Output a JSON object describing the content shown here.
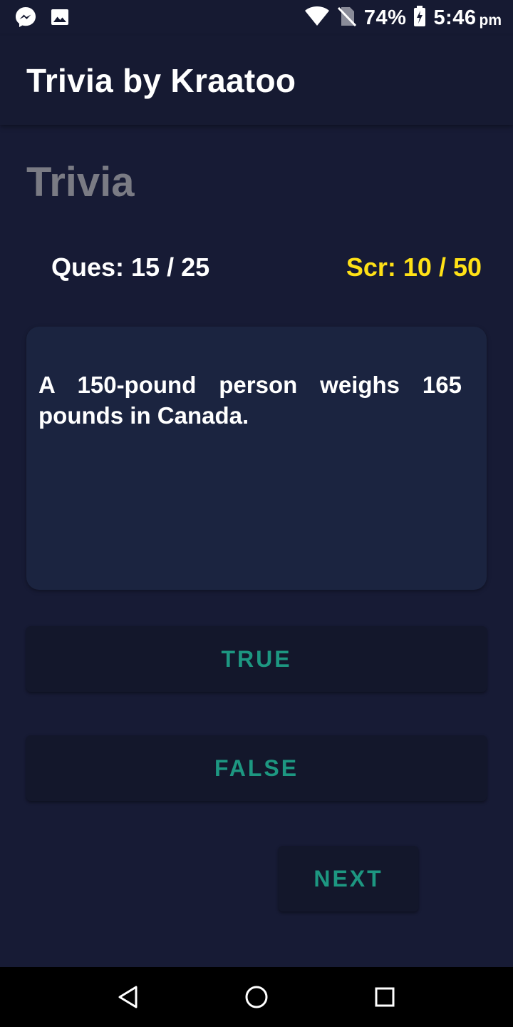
{
  "status_bar": {
    "icons_left": [
      "messenger-icon",
      "gallery-icon"
    ],
    "icons_right": [
      "wifi-icon",
      "no-sim-icon",
      "battery-charging-icon"
    ],
    "battery": "74%",
    "time": "5:46",
    "ampm": "pm"
  },
  "app_bar": {
    "title": "Trivia by Kraatoo"
  },
  "main": {
    "heading": "Trivia",
    "question_counter": "Ques: 15 / 25",
    "score": "Scr: 10 / 50",
    "question": "A 150-pound person weighs 165 pounds in Canada.",
    "answers": [
      "TRUE",
      "FALSE"
    ],
    "next_label": "NEXT"
  },
  "nav_bar": {
    "icons": [
      "back-icon",
      "home-icon",
      "recents-icon"
    ]
  },
  "colors": {
    "background": "#171b35",
    "card": "#1b2440",
    "button": "#13172b",
    "accent_teal": "#1d9781",
    "score_yellow": "#ffe116",
    "heading_gray": "#7a7b84"
  }
}
